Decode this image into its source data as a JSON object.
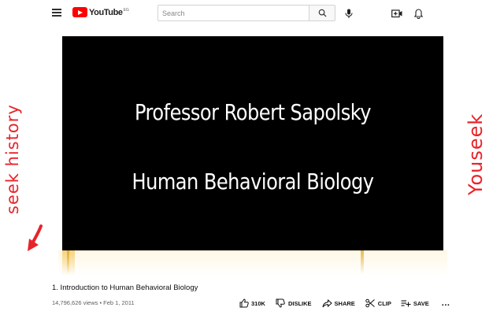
{
  "header": {
    "logo_text": "YouTube",
    "logo_country": "EG",
    "search_placeholder": "Search"
  },
  "overlay": {
    "left_text": "seek history",
    "right_text": "Youseek"
  },
  "player": {
    "title_line1": "Professor Robert Sapolsky",
    "title_line2": "Human Behavioral Biology"
  },
  "video": {
    "title": "1. Introduction to Human Behavioral Biology",
    "meta": "14,796,626 views • Feb 1, 2011"
  },
  "actions": {
    "like_count": "310K",
    "dislike_label": "DISLIKE",
    "share_label": "SHARE",
    "clip_label": "CLIP",
    "save_label": "SAVE",
    "more_label": "..."
  },
  "icons": [
    "menu-icon",
    "youtube-logo",
    "search-icon",
    "mic-icon",
    "create-video-icon",
    "bell-icon",
    "thumbs-up-icon",
    "thumbs-down-icon",
    "share-icon",
    "scissors-icon",
    "playlist-add-icon",
    "more-icon",
    "red-arrow-icon"
  ],
  "colors": {
    "accent_red": "#ff0000",
    "overlay_red": "#e8232a",
    "player_background": "#000000",
    "text": "#0f0f0f",
    "muted_text": "#606060"
  }
}
